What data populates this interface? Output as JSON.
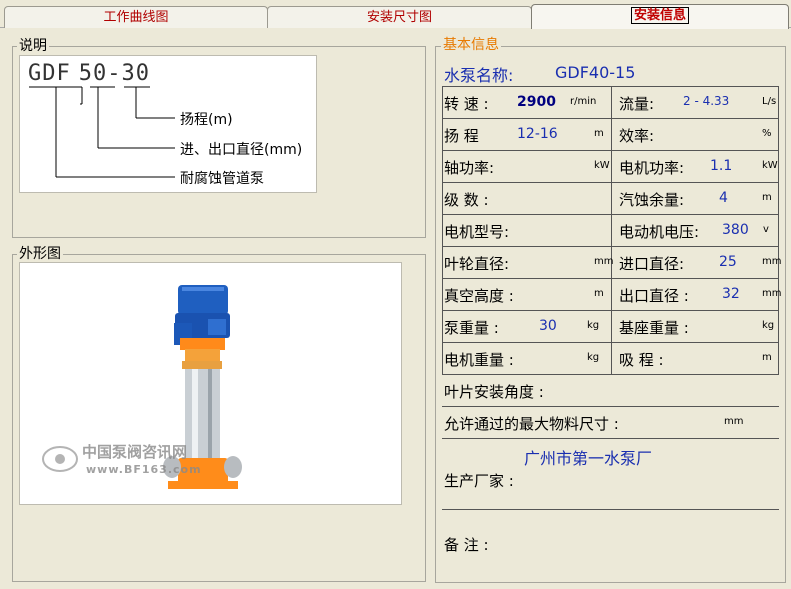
{
  "tabs": [
    "工作曲线图",
    "安装尺寸图",
    "安装信息"
  ],
  "legend": {
    "title": "说明",
    "model": {
      "prefix": "GDF",
      "size": "50-",
      "head": "30"
    },
    "items": [
      "扬程(m)",
      "进、出口直径(mm)",
      "耐腐蚀管道泵"
    ]
  },
  "outline": {
    "title": "外形图",
    "watermark": {
      "cn": "中国泵阀咨讯网",
      "url": "www.BF163.com"
    }
  },
  "info": {
    "title": "基本信息",
    "pump_name_label": "水泵名称:",
    "pump_name": "GDF40-15",
    "rows": [
      [
        {
          "label": "转 速 :",
          "value": "2900",
          "unit": "r/min"
        },
        {
          "label": "流量:",
          "value": "2 - 4.33",
          "unit": "L/s"
        }
      ],
      [
        {
          "label": "扬 程",
          "value": "12-16",
          "unit": "m"
        },
        {
          "label": "效率:",
          "value": "",
          "unit": "%"
        }
      ],
      [
        {
          "label": "轴功率:",
          "value": "",
          "unit": "kW"
        },
        {
          "label": "电机功率:",
          "value": "1.1",
          "unit": "kW"
        }
      ],
      [
        {
          "label": "级 数 :",
          "value": "",
          "unit": ""
        },
        {
          "label": "汽蚀余量:",
          "value": "4",
          "unit": "m"
        }
      ],
      [
        {
          "label": "电机型号:",
          "value": "",
          "unit": ""
        },
        {
          "label": "电动机电压:",
          "value": "380",
          "unit": "v"
        }
      ],
      [
        {
          "label": "叶轮直径:",
          "value": "",
          "unit": "mm"
        },
        {
          "label": "进口直径:",
          "value": "25",
          "unit": "mm"
        }
      ],
      [
        {
          "label": "真空高度 :",
          "value": "",
          "unit": "m"
        },
        {
          "label": "出口直径 :",
          "value": "32",
          "unit": "mm"
        }
      ],
      [
        {
          "label": "泵重量 :",
          "value": "30",
          "unit": "kg"
        },
        {
          "label": "基座重量 :",
          "value": "",
          "unit": "kg"
        }
      ],
      [
        {
          "label": "电机重量 :",
          "value": "",
          "unit": "kg"
        },
        {
          "label": "吸 程 :",
          "value": "",
          "unit": "m"
        }
      ]
    ],
    "blade_angle_label": "叶片安装角度 :",
    "max_particle_label": "允许通过的最大物料尺寸 :",
    "max_particle_unit": "mm",
    "manufacturer": "广州市第一水泵厂",
    "manufacturer_label": "生产厂家 :",
    "remark_label": "备 注 :"
  },
  "colors": {
    "accent": "#c00000",
    "value_blue": "#1a2fb0",
    "group_title": "#e87a00"
  }
}
